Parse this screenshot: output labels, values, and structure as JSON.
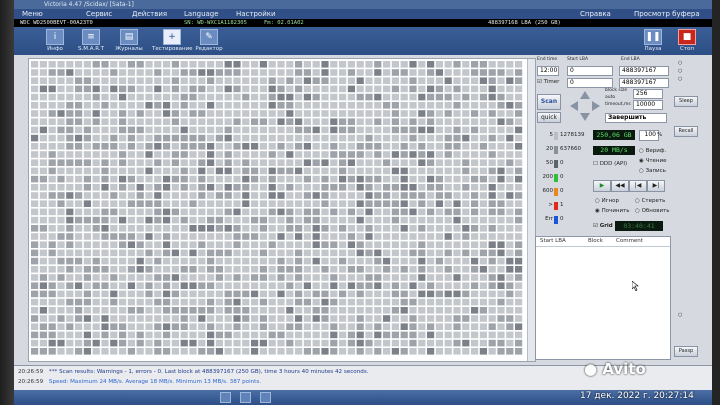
{
  "window_title": "Victoria 4.47 /Scidax/ [Sata-1]",
  "menu": {
    "items": [
      "Меню",
      "Сервис",
      "Действия",
      "Language",
      "Настройки",
      "Справка"
    ],
    "buffer_view": "Просмотр буфера"
  },
  "drive_info": {
    "model": "WDC WD2500BEVT-00A23T0",
    "serial": "SN: WD-WXC1A1182305",
    "firmware": "Fm: 02.01A02",
    "capacity": "488397168 LBA (250 GB)"
  },
  "toolbar": {
    "buttons": [
      {
        "icon": "info-icon",
        "glyph": "i",
        "label": "Инфо"
      },
      {
        "icon": "smart-icon",
        "glyph": "≡",
        "label": "S.M.A.R.T"
      },
      {
        "icon": "journal-icon",
        "glyph": "▤",
        "label": "Журналы"
      },
      {
        "icon": "test-icon",
        "glyph": "+",
        "label": "Тестирование"
      },
      {
        "icon": "editor-icon",
        "glyph": "✎",
        "label": "Редактор"
      }
    ],
    "pause_label": "Пауза",
    "stop_label": "Стоп"
  },
  "scan_controls": {
    "end_time_label": "End time",
    "start_lba_label": "Start LBA",
    "end_lba_label": "End LBA",
    "time_value": "12:00",
    "start_lba_value": "0",
    "end_lba_value": "488397167",
    "timer_label": "Timer",
    "timer_value": "0",
    "end_lba_value_2": "488397167",
    "block_size_label": "block size",
    "auto_label": "auto",
    "timeout_label": "timeout,ms",
    "block_size_value": "256",
    "timeout_value": "10000",
    "scan_button": "Scan",
    "quick_button": "quick",
    "end_action": "Завершить"
  },
  "stats": {
    "buckets": [
      {
        "label": "5",
        "count": "1278139",
        "color": "#b9bec6"
      },
      {
        "label": "20",
        "count": "637660",
        "color": "#8a9098"
      },
      {
        "label": "50",
        "count": "0",
        "color": "#5c636b"
      },
      {
        "label": "200",
        "count": "0",
        "color": "#2fbf3b"
      },
      {
        "label": "600",
        "count": "0",
        "color": "#e8881e"
      },
      {
        "label": ">",
        "count": "1",
        "color": "#e12a1a"
      },
      {
        "label": "Err",
        "count": "0",
        "color": "#1b56d8"
      }
    ],
    "capacity_display": "250,06 GB",
    "percent_value": "100",
    "percent_sign": "%",
    "speed_display": "20 MB/s",
    "ddd_label": "DDD (API)",
    "modes": [
      "Вериф.",
      "Чтение",
      "Запись"
    ],
    "modes_selected": "Чтение"
  },
  "error_actions": {
    "options": [
      "Игнор",
      "Стереть",
      "Починить",
      "Обновить"
    ],
    "selected": "Починить",
    "grid_label": "Grid",
    "timer_display": "03:40:41"
  },
  "bad_table": {
    "columns": [
      "Start LBA",
      "Block",
      "Comment"
    ]
  },
  "side_buttons": {
    "sleep": "Sleep",
    "recall": "Recall",
    "passp": "Passp"
  },
  "log": {
    "lines": [
      {
        "time": "20:26:59",
        "text": "*** Scan results: Warnings - 1, errors - 0. Last block at 488397167 (250 GB), time 3 hours 40 minutes 42 seconds.",
        "color": "#203a8a"
      },
      {
        "time": "20:26:59",
        "text": "Speed: Maximum 24 MB/s. Average 18 MB/s. Minimum 13 MB/s. 387 points.",
        "color": "#2f66d0"
      }
    ]
  },
  "overlay": {
    "watermark": "Avito",
    "timestamp": "17 дек. 2022 г. 20:27:14"
  }
}
